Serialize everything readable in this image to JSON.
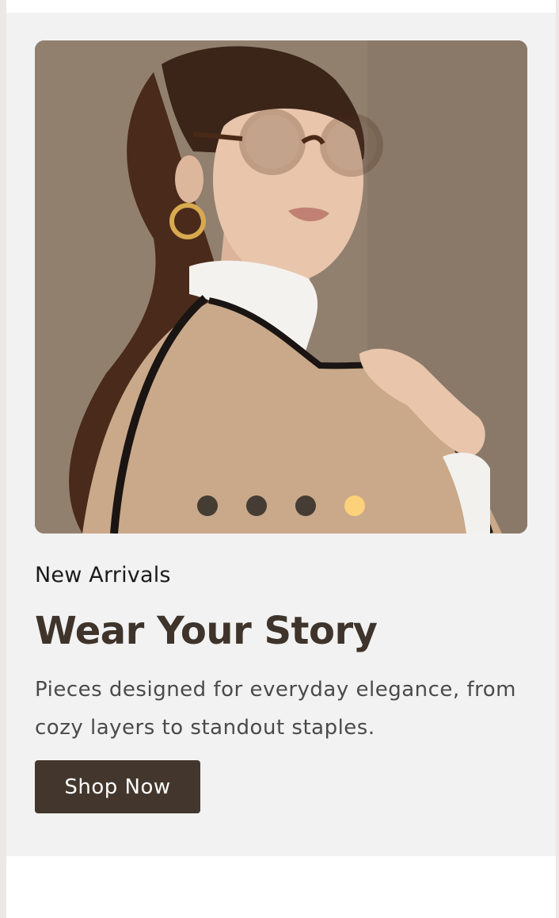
{
  "hero": {
    "image_alt": "Model wearing round tortoiseshell glasses and a beige poncho",
    "carousel": {
      "dot_count": 4,
      "active_index": 3,
      "active_color": "#fdd17a",
      "inactive_color": "#3a332d"
    },
    "eyebrow": "New Arrivals",
    "headline": "Wear Your Story",
    "description": "Pieces designed for everyday elegance, from cozy layers to standout staples.",
    "cta_label": "Shop Now"
  },
  "colors": {
    "card_background": "#f2f2f2",
    "button_background": "#43372d",
    "headline_color": "#3e342b"
  }
}
